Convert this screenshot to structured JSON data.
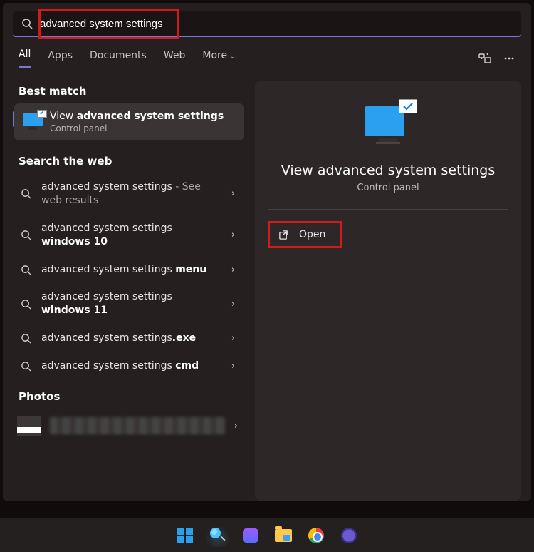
{
  "search": {
    "value": "advanced system settings"
  },
  "tabs": {
    "all": "All",
    "apps": "Apps",
    "documents": "Documents",
    "web": "Web",
    "more": "More"
  },
  "sections": {
    "best_match": "Best match",
    "search_web": "Search the web",
    "photos": "Photos"
  },
  "best_match": {
    "prefix": "View ",
    "bold": "advanced system settings",
    "subtitle": "Control panel"
  },
  "web_results": [
    {
      "prefix": "advanced system settings",
      "trail": " - See web results"
    },
    {
      "prefix": "advanced system settings ",
      "bold": "windows 10"
    },
    {
      "prefix": "advanced system settings ",
      "bold": "menu"
    },
    {
      "prefix": "advanced system settings ",
      "bold": "windows 11"
    },
    {
      "prefix": "advanced system settings",
      "bold": ".exe"
    },
    {
      "prefix": "advanced system settings ",
      "bold": "cmd"
    }
  ],
  "detail": {
    "title": "View advanced system settings",
    "subtitle": "Control panel",
    "open_label": "Open"
  },
  "colors": {
    "accent": "#7a76d6",
    "highlight": "#d11a1a",
    "blue": "#2aa0ef"
  }
}
